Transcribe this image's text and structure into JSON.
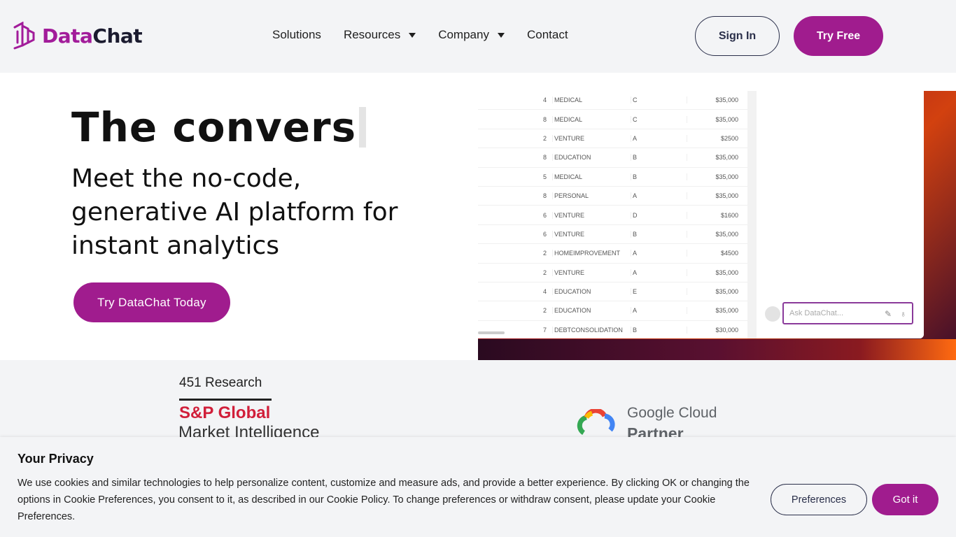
{
  "brand": {
    "name_part1": "Data",
    "name_part2": "Chat",
    "primary_color": "#a01c8e",
    "dark_color": "#2a2f4a"
  },
  "nav": {
    "items": [
      {
        "label": "Solutions",
        "has_dropdown": false
      },
      {
        "label": "Resources",
        "has_dropdown": true
      },
      {
        "label": "Company",
        "has_dropdown": true
      },
      {
        "label": "Contact",
        "has_dropdown": false
      }
    ],
    "sign_in_label": "Sign In",
    "try_free_label": "Try Free"
  },
  "hero": {
    "title_typed": "The convers",
    "subtitle": "Meet the no-code, generative AI platform for instant analytics",
    "cta_label": "Try DataChat Today"
  },
  "preview": {
    "table_rows": [
      [
        "4",
        "MEDICAL",
        "C",
        "$35,000"
      ],
      [
        "8",
        "MEDICAL",
        "C",
        "$35,000"
      ],
      [
        "2",
        "VENTURE",
        "A",
        "$2500"
      ],
      [
        "8",
        "EDUCATION",
        "B",
        "$35,000"
      ],
      [
        "5",
        "MEDICAL",
        "B",
        "$35,000"
      ],
      [
        "8",
        "PERSONAL",
        "A",
        "$35,000"
      ],
      [
        "6",
        "VENTURE",
        "D",
        "$1600"
      ],
      [
        "6",
        "VENTURE",
        "B",
        "$35,000"
      ],
      [
        "2",
        "HOMEIMPROVEMENT",
        "A",
        "$4500"
      ],
      [
        "2",
        "VENTURE",
        "A",
        "$35,000"
      ],
      [
        "4",
        "EDUCATION",
        "E",
        "$35,000"
      ],
      [
        "2",
        "EDUCATION",
        "A",
        "$35,000"
      ],
      [
        "7",
        "DEBTCONSOLIDATION",
        "B",
        "$30,000"
      ]
    ],
    "chat_placeholder": "Ask DataChat..."
  },
  "logos": {
    "research_name": "451 Research",
    "research_brand": "S&P Global",
    "research_sub": "Market Intelligence",
    "google_line1": "Google Cloud",
    "google_line2": "Partner"
  },
  "privacy": {
    "title": "Your Privacy",
    "text": "We use cookies and similar technologies to help personalize content, customize and measure ads, and provide a better experience. By clicking OK or changing the options in Cookie Preferences, you consent to it, as described in our Cookie Policy. To change preferences or withdraw consent, please update your Cookie Preferences.",
    "preferences_label": "Preferences",
    "gotit_label": "Got it"
  }
}
